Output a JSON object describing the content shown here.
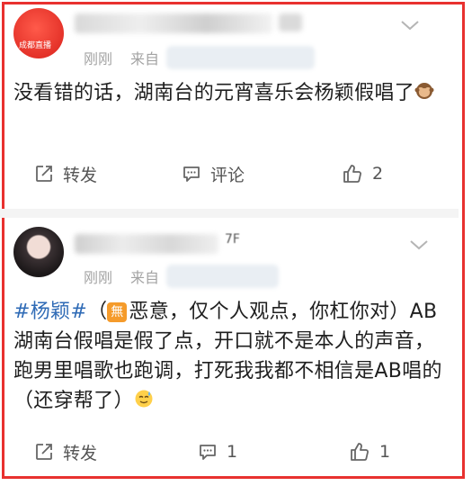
{
  "colors": {
    "border": "#e8312f",
    "hashtag": "#2f6bb6",
    "badge": "#f59b2b"
  },
  "posts": [
    {
      "avatar_text": "成都直播",
      "time": "刚刚",
      "source_label": "来自",
      "content": "没看错的话，湖南台的元宵喜乐会杨颖假唱了",
      "content_emoji": "see-no-evil-monkey",
      "actions": {
        "repost_label": "转发",
        "comment_label": "评论",
        "like_count": "2"
      }
    },
    {
      "username_tail": "7F",
      "time": "刚刚",
      "source_label": "来自",
      "hashtag": "#杨颖#",
      "content_intro": "（",
      "badge_text": "無",
      "content_line1": "恶意，仅个人观点，你杠你对）",
      "content_rest": "AB湖南台假唱是假了点，开口就不是本人的声音，跑男里唱歌也跑调，打死我我都不相信是AB唱的（还穿帮了）",
      "content_emoji": "sweat-smile-face",
      "actions": {
        "repost_label": "转发",
        "comment_count": "1",
        "like_count": "1"
      }
    }
  ]
}
